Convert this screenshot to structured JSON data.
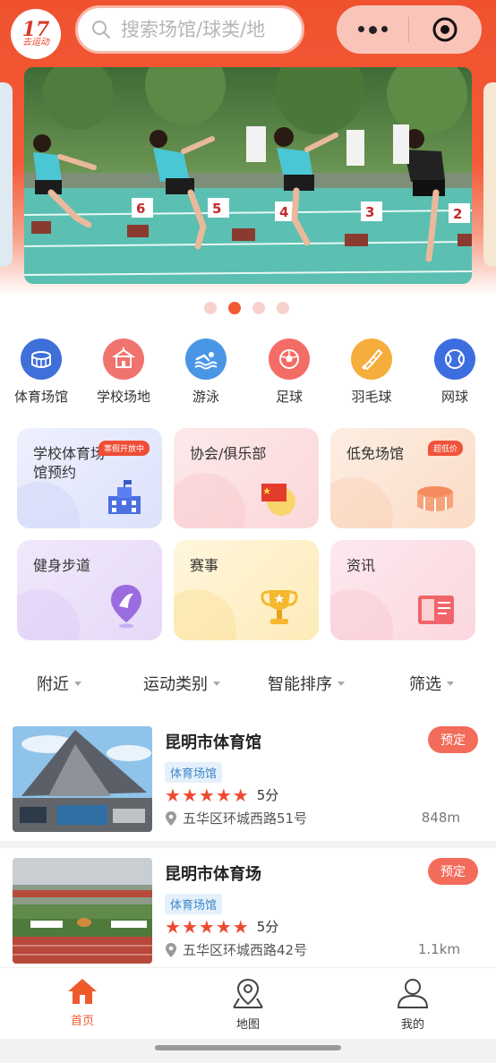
{
  "header": {
    "logo_number": "17",
    "logo_text": "去运动",
    "search_placeholder": "搜索场馆/球类/地"
  },
  "banner": {
    "lane_numbers": [
      "6",
      "5",
      "4",
      "3",
      "2"
    ],
    "page_count": 4,
    "active_page": 2
  },
  "categories": [
    {
      "label": "体育场馆",
      "icon": "stadium-icon",
      "color": "#3f6fd8"
    },
    {
      "label": "学校场地",
      "icon": "school-icon",
      "color": "#f07370"
    },
    {
      "label": "游泳",
      "icon": "swimming-icon",
      "color": "#4a96e6"
    },
    {
      "label": "足球",
      "icon": "football-icon",
      "color": "#f36d66"
    },
    {
      "label": "羽毛球",
      "icon": "badminton-icon",
      "color": "#f5ad3c"
    },
    {
      "label": "网球",
      "icon": "tennis-icon",
      "color": "#3d6ee0"
    }
  ],
  "tiles": [
    {
      "title": "学校体育场馆预约",
      "badge": "寒假开放中",
      "icon": "school-building-icon"
    },
    {
      "title": "协会/俱乐部",
      "badge": "",
      "icon": "flag-icon"
    },
    {
      "title": "低免场馆",
      "badge": "超低价",
      "icon": "arena-icon"
    },
    {
      "title": "健身步道",
      "badge": "",
      "icon": "location-pin-icon"
    },
    {
      "title": "赛事",
      "badge": "",
      "icon": "trophy-icon"
    },
    {
      "title": "资讯",
      "badge": "",
      "icon": "book-icon"
    }
  ],
  "filters": [
    "附近",
    "运动类别",
    "智能排序",
    "筛选"
  ],
  "venues": [
    {
      "name": "昆明市体育馆",
      "tag": "体育场馆",
      "rating": 5,
      "score": "5分",
      "address": "五华区环城西路51号",
      "distance": "848m",
      "book": "预定"
    },
    {
      "name": "昆明市体育场",
      "tag": "体育场馆",
      "rating": 5,
      "score": "5分",
      "address": "五华区环城西路42号",
      "distance": "1.1km",
      "book": "预定"
    }
  ],
  "tabbar": [
    {
      "label": "首页",
      "icon": "home-icon",
      "active": true
    },
    {
      "label": "地图",
      "icon": "map-pin-icon",
      "active": false
    },
    {
      "label": "我的",
      "icon": "user-icon",
      "active": false
    }
  ],
  "colors": {
    "brand": "#f0522f",
    "accent": "#ee4a31",
    "tag_blue": "#3f88c7"
  }
}
